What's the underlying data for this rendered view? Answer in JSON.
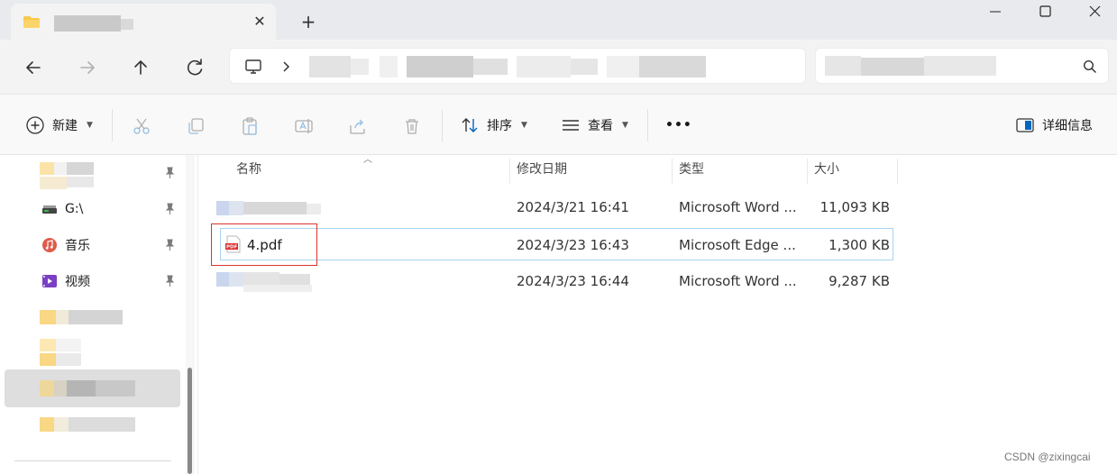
{
  "window": {
    "tab_close_glyph": "✕",
    "new_tab_glyph": "+"
  },
  "commandbar": {
    "new_label": "新建",
    "sort_label": "排序",
    "view_label": "查看",
    "more_glyph": "•••",
    "details_label": "详细信息"
  },
  "sidebar": {
    "items": [
      {
        "label": "G:\\",
        "icon": "drive-icon"
      },
      {
        "label": "音乐",
        "icon": "music-icon"
      },
      {
        "label": "视频",
        "icon": "video-icon"
      }
    ]
  },
  "filelist": {
    "columns": [
      "名称",
      "修改日期",
      "类型",
      "大小"
    ],
    "rows": [
      {
        "name": "",
        "modified": "2024/3/21 16:41",
        "type": "Microsoft Word ...",
        "size": "11,093 KB"
      },
      {
        "name": "4.pdf",
        "modified": "2024/3/23 16:43",
        "type": "Microsoft Edge ...",
        "size": "1,300 KB",
        "selected": true
      },
      {
        "name": "",
        "modified": "2024/3/23 16:44",
        "type": "Microsoft Word ...",
        "size": "9,287 KB"
      }
    ]
  },
  "watermark": "CSDN @zixingcai",
  "colors": {
    "accent": "#0067c0",
    "selection_border": "#a8d3f0",
    "annotation": "#d9332c",
    "folder_yellow": "#f8c94a"
  }
}
